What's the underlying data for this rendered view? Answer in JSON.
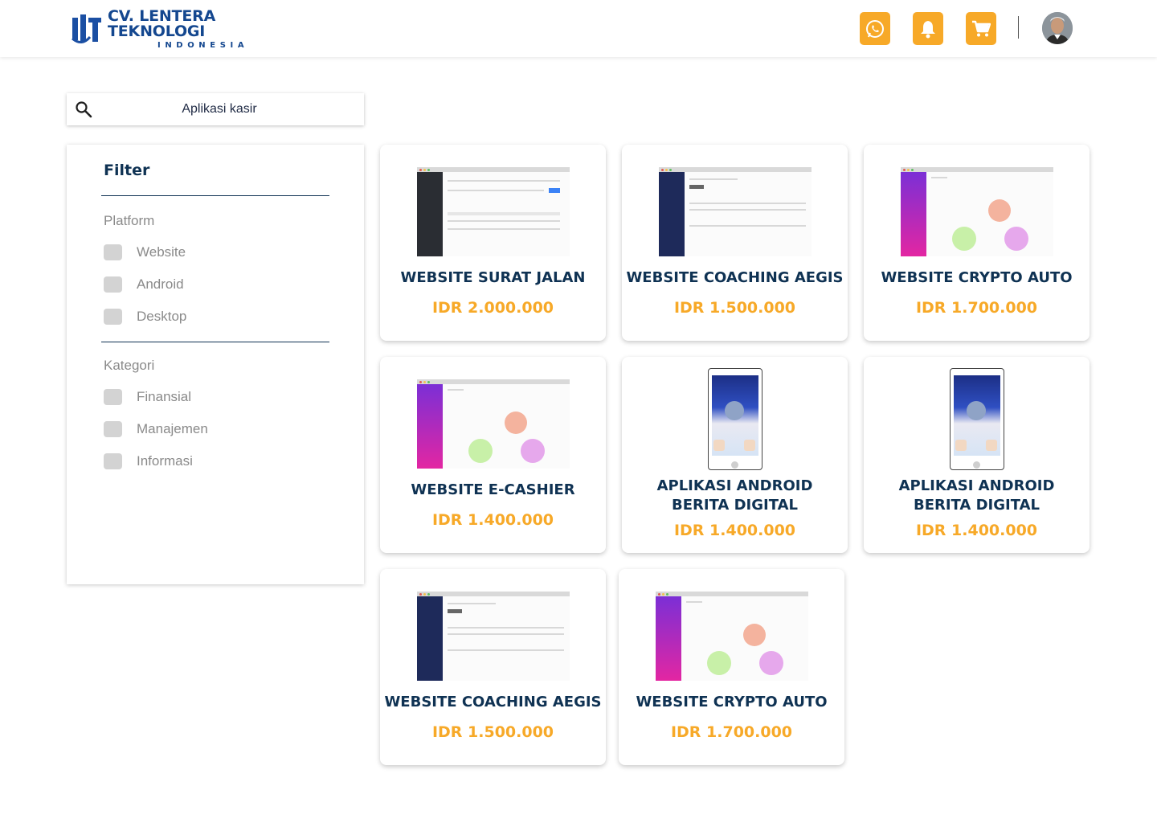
{
  "brand": {
    "name": "CV. LENTERA TEKNOLOGI",
    "subtitle": "INDONESIA",
    "accent_color": "#f7a928",
    "primary_color": "#0f3253"
  },
  "header": {
    "buttons": [
      {
        "name": "whatsapp-button",
        "icon": "whatsapp-icon"
      },
      {
        "name": "notification-button",
        "icon": "bell-icon"
      },
      {
        "name": "cart-button",
        "icon": "cart-icon"
      }
    ]
  },
  "search": {
    "value": "Aplikasi kasir"
  },
  "filter": {
    "title": "Filter",
    "platform": {
      "label": "Platform",
      "options": [
        "Website",
        "Android",
        "Desktop"
      ]
    },
    "category": {
      "label": "Kategori",
      "options": [
        "Finansial",
        "Manajemen",
        "Informasi"
      ]
    }
  },
  "products": [
    {
      "title": "WEBSITE SURAT JALAN",
      "price": "IDR 2.000.000",
      "thumb": "dark-admin"
    },
    {
      "title": "WEBSITE COACHING AEGIS",
      "price": "IDR 1.500.000",
      "thumb": "navy-admin"
    },
    {
      "title": "WEBSITE CRYPTO AUTO",
      "price": "IDR 1.700.000",
      "thumb": "gradient-tree"
    },
    {
      "title": "WEBSITE E-CASHIER",
      "price": "IDR 1.400.000",
      "thumb": "gradient-tree"
    },
    {
      "title_line1": "APLIKASI ANDROID",
      "title_line2": "BERITA DIGITAL",
      "price": "IDR 1.400.000",
      "thumb": "phone"
    },
    {
      "title_line1": "APLIKASI ANDROID",
      "title_line2": "BERITA DIGITAL",
      "price": "IDR 1.400.000",
      "thumb": "phone"
    },
    {
      "title": "WEBSITE COACHING AEGIS",
      "price": "IDR 1.500.000",
      "thumb": "navy-admin"
    },
    {
      "title": "WEBSITE CRYPTO AUTO",
      "price": "IDR 1.700.000",
      "thumb": "gradient-tree"
    }
  ]
}
